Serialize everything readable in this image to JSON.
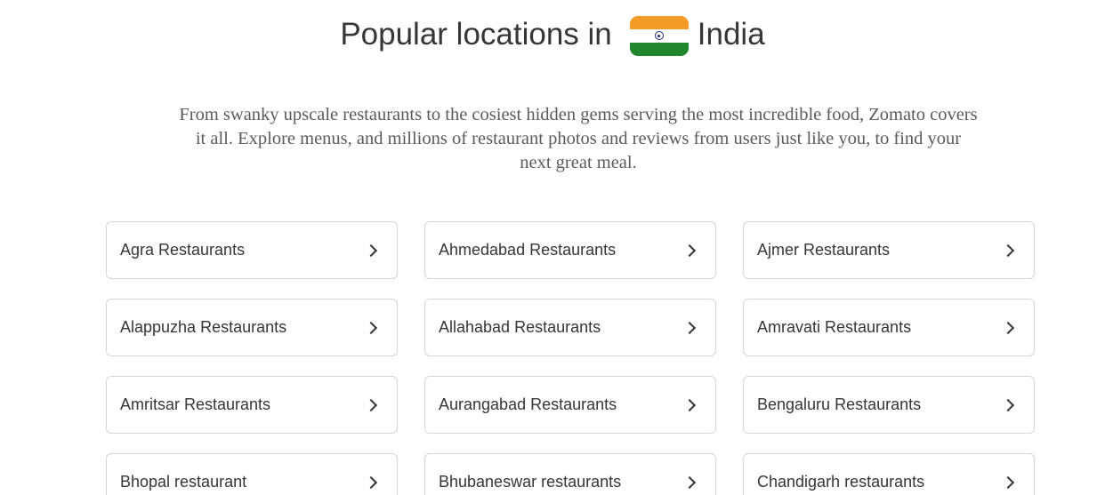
{
  "heading": {
    "prefix": "Popular locations in",
    "country": "India",
    "flag_icon": "india-flag-icon"
  },
  "description": "From swanky upscale restaurants to the cosiest hidden gems serving the most incredible food, Zomato covers it all. Explore menus, and millions of restaurant photos and reviews from users just like you, to find your next great meal.",
  "locations": [
    {
      "label": "Agra Restaurants"
    },
    {
      "label": "Ahmedabad Restaurants"
    },
    {
      "label": "Ajmer Restaurants"
    },
    {
      "label": "Alappuzha Restaurants"
    },
    {
      "label": "Allahabad Restaurants"
    },
    {
      "label": "Amravati Restaurants"
    },
    {
      "label": "Amritsar Restaurants"
    },
    {
      "label": "Aurangabad Restaurants"
    },
    {
      "label": "Bengaluru Restaurants"
    },
    {
      "label": "Bhopal restaurant"
    },
    {
      "label": "Bhubaneswar restaurants"
    },
    {
      "label": "Chandigarh restaurants"
    }
  ],
  "chevron_icon": "chevron-right-icon",
  "colors": {
    "text": "#363636",
    "description": "#5b5b5b",
    "border": "#d6d6d6"
  }
}
